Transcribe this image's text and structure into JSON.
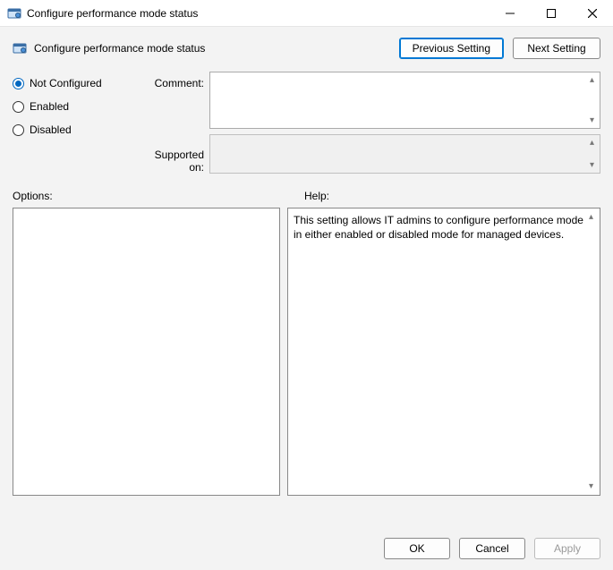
{
  "window": {
    "title": "Configure performance mode status"
  },
  "subheader": {
    "title": "Configure performance mode status"
  },
  "nav": {
    "prev": "Previous Setting",
    "next": "Next Setting"
  },
  "state": {
    "not_configured": "Not Configured",
    "enabled": "Enabled",
    "disabled": "Disabled",
    "selected": "not_configured"
  },
  "labels": {
    "comment": "Comment:",
    "supported": "Supported on:",
    "options": "Options:",
    "help": "Help:"
  },
  "fields": {
    "comment": "",
    "supported": ""
  },
  "help_text": "This setting allows IT admins to configure performance mode in either enabled or disabled mode for managed devices.",
  "buttons": {
    "ok": "OK",
    "cancel": "Cancel",
    "apply": "Apply"
  }
}
